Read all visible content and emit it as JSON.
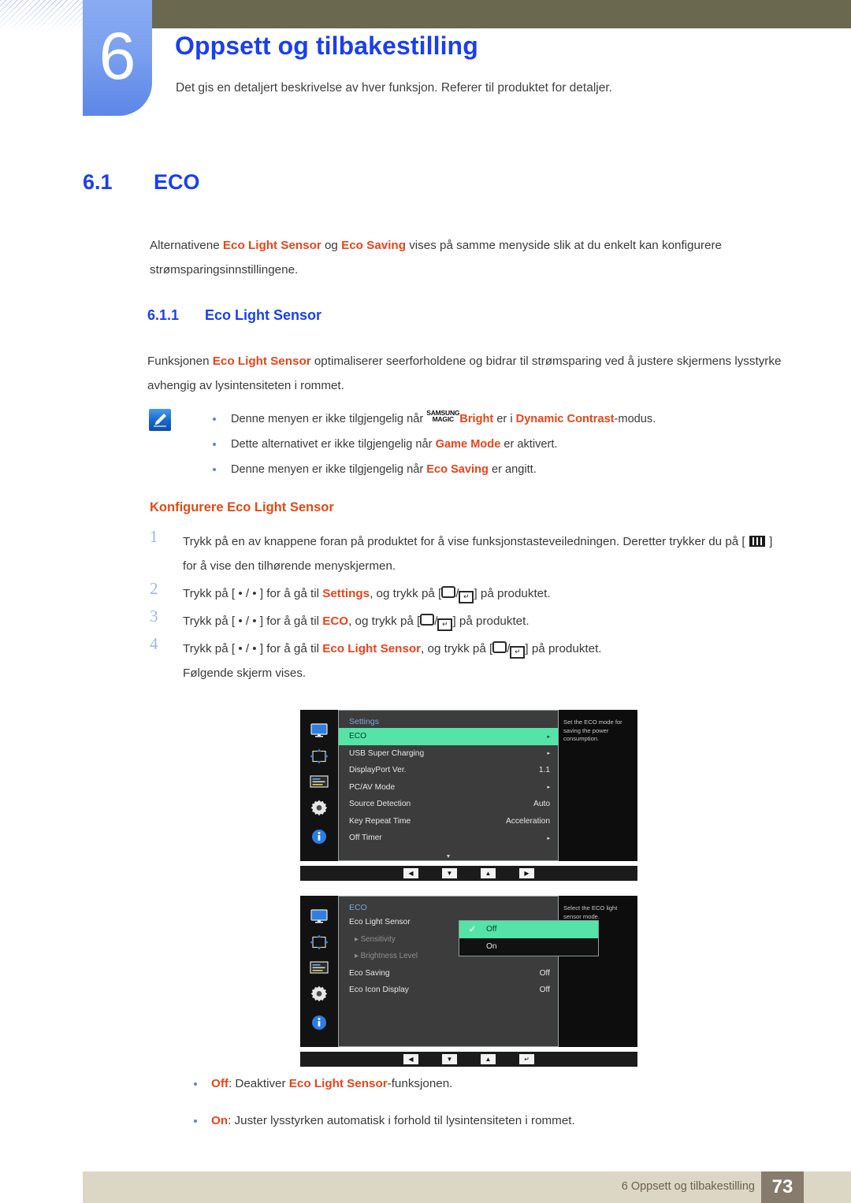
{
  "header": {
    "chapter_number": "6",
    "chapter_title": "Oppsett og tilbakestilling",
    "chapter_subtitle": "Det gis en detaljert beskrivelse av hver funksjon. Referer til produktet for detaljer."
  },
  "section": {
    "number": "6.1",
    "title": "ECO",
    "intro_1": "Alternativene ",
    "intro_term_1": "Eco Light Sensor",
    "intro_2": " og ",
    "intro_term_2": "Eco Saving",
    "intro_3": " vises på samme menyside slik at du enkelt kan konfigurere strømsparingsinnstillingene."
  },
  "subsection": {
    "number": "6.1.1",
    "title": "Eco Light Sensor",
    "intro_1": "Funksjonen ",
    "intro_term": "Eco Light Sensor",
    "intro_2": " optimaliserer seerforholdene og bidrar til strømsparing ved å justere skjermens lysstyrke avhengig av lysintensiteten i rommet."
  },
  "note": {
    "icon": "note-pen-icon",
    "items": [
      {
        "pre": "Denne menyen er ikke tilgjengelig når ",
        "magic_top": "SAMSUNG",
        "magic_bottom": "MAGIC",
        "term_1": "Bright",
        "mid": " er i ",
        "term_2": "Dynamic Contrast",
        "post": "-modus."
      },
      {
        "pre": "Dette alternativet er ikke tilgjengelig når ",
        "term_1": "Game Mode",
        "post": " er aktivert."
      },
      {
        "pre": "Denne menyen er ikke tilgjengelig når ",
        "term_1": "Eco Saving",
        "post": " er angitt."
      }
    ]
  },
  "procedure": {
    "heading": "Konfigurere Eco Light Sensor",
    "steps": [
      {
        "num": "1",
        "text_1": "Trykk på en av knappene foran på produktet for å vise funksjonstasteveiledningen. Deretter trykker du på [ ",
        "icon": "menu-key-icon",
        "text_2": " ] for å vise den tilhørende menyskjermen."
      },
      {
        "num": "2",
        "pre": "Trykk på [ • / • ] for å gå til ",
        "term": "Settings",
        "mid": ", og trykk på [",
        "post": "] på produktet."
      },
      {
        "num": "3",
        "pre": "Trykk på [ • / • ] for å gå til ",
        "term": "ECO",
        "mid": ", og trykk på [",
        "post": "] på produktet."
      },
      {
        "num": "4",
        "pre": "Trykk på [ • / • ] for å gå til ",
        "term": "Eco Light Sensor",
        "mid": ", og trykk på [",
        "post": "] på produktet."
      }
    ],
    "after_text": "Følgende skjerm vises."
  },
  "osd_settings": {
    "title": "Settings",
    "help": "Set the ECO mode for saving the power consumption.",
    "side_icons": [
      "monitor-icon",
      "position-arrows-icon",
      "osd-panel-icon",
      "gear-icon",
      "info-icon"
    ],
    "rows": [
      {
        "label": "ECO",
        "value": "▸",
        "selected": true
      },
      {
        "label": "USB Super Charging",
        "value": "▸",
        "selected": false
      },
      {
        "label": "DisplayPort Ver.",
        "value": "1.1",
        "selected": false
      },
      {
        "label": "PC/AV Mode",
        "value": "▸",
        "selected": false
      },
      {
        "label": "Source Detection",
        "value": "Auto",
        "selected": false
      },
      {
        "label": "Key Repeat Time",
        "value": "Acceleration",
        "selected": false
      },
      {
        "label": "Off Timer",
        "value": "▸",
        "selected": false
      }
    ],
    "scroll_indicator": "▼",
    "nav_buttons": [
      "◀",
      "▼",
      "▲",
      "▶"
    ]
  },
  "osd_eco": {
    "title": "ECO",
    "help": "Select the ECO light sensor mode.",
    "side_icons": [
      "monitor-icon",
      "position-arrows-icon",
      "osd-panel-icon",
      "gear-icon",
      "info-icon"
    ],
    "rows": [
      {
        "label": "Eco Light Sensor",
        "value": "",
        "dim": false
      },
      {
        "label": "▸ Sensitivity",
        "value": "",
        "dim": true
      },
      {
        "label": "▸ Brightness Level",
        "value": "",
        "dim": true
      },
      {
        "label": "Eco Saving",
        "value": "Off",
        "dim": false
      },
      {
        "label": "Eco Icon Display",
        "value": "Off",
        "dim": false
      }
    ],
    "popup_options": [
      {
        "label": "Off",
        "checked": true
      },
      {
        "label": "On",
        "checked": false
      }
    ],
    "nav_buttons": [
      "◀",
      "▼",
      "▲",
      "↵"
    ]
  },
  "options": [
    {
      "term": "Off",
      "sep": ": ",
      "pre": "Deaktiver ",
      "term2": "Eco Light Sensor",
      "post": "-funksjonen."
    },
    {
      "term": "On",
      "sep": ": ",
      "pre": "Juster lysstyrken automatisk i forhold til lysintensiteten i rommet.",
      "term2": "",
      "post": ""
    }
  ],
  "footer": {
    "text": "6 Oppsett og tilbakestilling",
    "page": "73"
  },
  "colors": {
    "accent_blue": "#1a3ff0",
    "accent_red": "#e8441a",
    "olive": "#6b6850",
    "footer_bg": "#dcd6c4",
    "page_box": "#867b6c",
    "osd_highlight": "#55e3a8"
  }
}
